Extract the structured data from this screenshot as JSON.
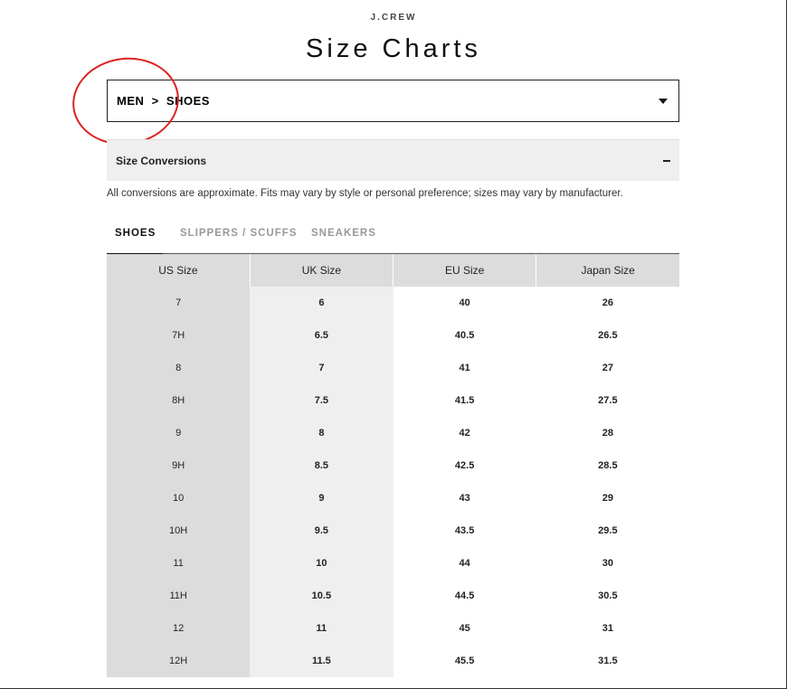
{
  "brand": "J.CREW",
  "page_title": "Size Charts",
  "selector": {
    "label": "MEN  >  SHOES"
  },
  "accordion": {
    "label": "Size Conversions",
    "toggle": "–"
  },
  "disclaimer": "All conversions are approximate. Fits may vary by style or personal preference; sizes may vary by manufacturer.",
  "tabs": [
    {
      "label": "SHOES",
      "active": true
    },
    {
      "label": "SLIPPERS / SCUFFS",
      "active": false
    },
    {
      "label": "SNEAKERS",
      "active": false
    }
  ],
  "table": {
    "headers": [
      "US Size",
      "UK Size",
      "EU Size",
      "Japan Size"
    ],
    "rows": [
      [
        "7",
        "6",
        "40",
        "26"
      ],
      [
        "7H",
        "6.5",
        "40.5",
        "26.5"
      ],
      [
        "8",
        "7",
        "41",
        "27"
      ],
      [
        "8H",
        "7.5",
        "41.5",
        "27.5"
      ],
      [
        "9",
        "8",
        "42",
        "28"
      ],
      [
        "9H",
        "8.5",
        "42.5",
        "28.5"
      ],
      [
        "10",
        "9",
        "43",
        "29"
      ],
      [
        "10H",
        "9.5",
        "43.5",
        "29.5"
      ],
      [
        "11",
        "10",
        "44",
        "30"
      ],
      [
        "11H",
        "10.5",
        "44.5",
        "30.5"
      ],
      [
        "12",
        "11",
        "45",
        "31"
      ],
      [
        "12H",
        "11.5",
        "45.5",
        "31.5"
      ]
    ]
  },
  "colors": {
    "annotation": "#dd2222",
    "header_bg": "#dcdcdc",
    "uk_col_bg": "#efefef"
  }
}
